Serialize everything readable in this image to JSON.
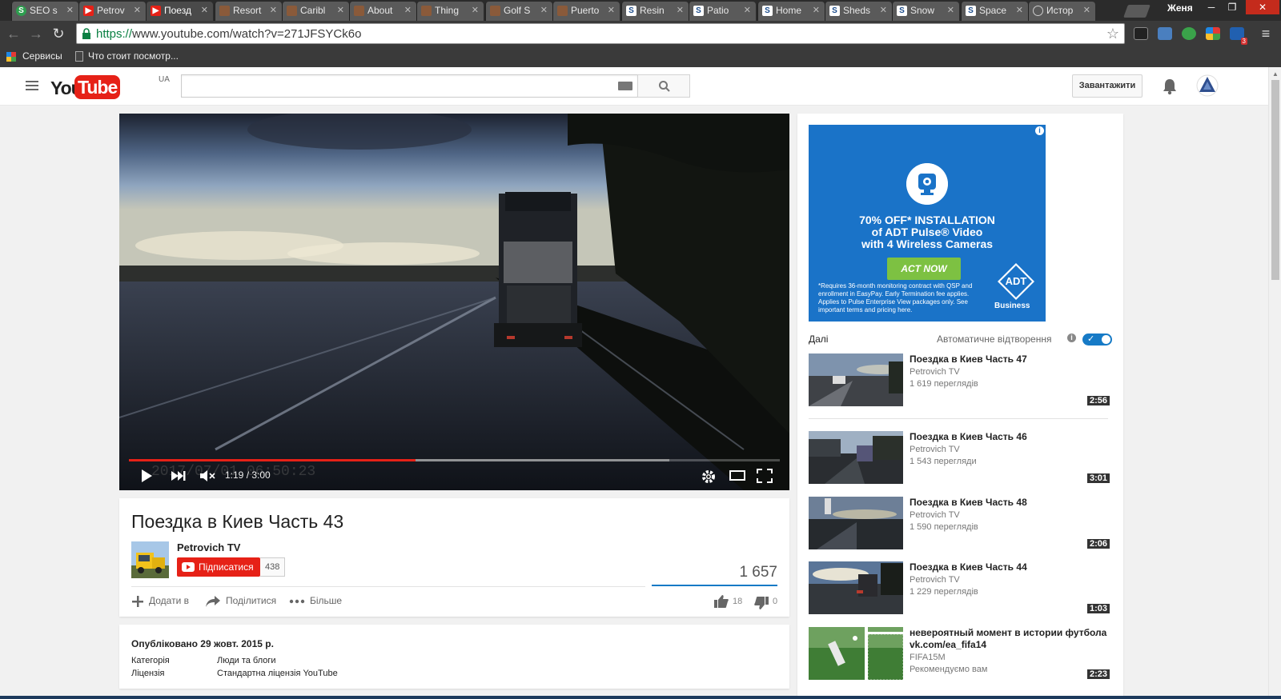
{
  "browser": {
    "tabs": [
      {
        "label": "SEO s",
        "favicon": "seo-icon"
      },
      {
        "label": "Petrov",
        "favicon": "youtube-icon"
      },
      {
        "label": "Поезд",
        "favicon": "youtube-icon"
      },
      {
        "label": "Resort",
        "favicon": "pottery-icon"
      },
      {
        "label": "Caribl",
        "favicon": "pottery-icon"
      },
      {
        "label": "About",
        "favicon": "pottery-icon"
      },
      {
        "label": "Thing",
        "favicon": "pottery-icon"
      },
      {
        "label": "Golf S",
        "favicon": "pottery-icon"
      },
      {
        "label": "Puerto",
        "favicon": "pottery-icon"
      },
      {
        "label": "Resin",
        "favicon": "s-icon"
      },
      {
        "label": "Patio",
        "favicon": "s-icon"
      },
      {
        "label": "Home",
        "favicon": "s-icon"
      },
      {
        "label": "Sheds",
        "favicon": "s-icon"
      },
      {
        "label": "Snow",
        "favicon": "s-icon"
      },
      {
        "label": "Space",
        "favicon": "s-icon"
      },
      {
        "label": "Истор",
        "favicon": "history-icon"
      }
    ],
    "user": "Женя",
    "url_scheme": "https://",
    "url_rest": "www.youtube.com/watch?v=271JFSYCk6o",
    "bookmarks": {
      "apps": "Сервисы",
      "item1": "Что стоит посмотр..."
    },
    "extension_badge": "3"
  },
  "masthead": {
    "logo_you": "You",
    "logo_tube": "Tube",
    "country": "UA",
    "search_placeholder": "",
    "upload_label": "Завантажити"
  },
  "player": {
    "time_current": "1:19",
    "time_total": "3:00",
    "time_display": "1:19 / 3:00",
    "played_fraction": 0.44,
    "loaded_fraction": 0.83
  },
  "video": {
    "title": "Поездка в Киев Часть 43",
    "channel": "Petrovich TV",
    "subscribe_label": "Підписатися",
    "subscriber_count": "438",
    "views": "1 657",
    "actions": {
      "add": "Додати в",
      "share": "Поділитися",
      "more": "Більше"
    },
    "likes": "18",
    "dislikes": "0",
    "published": "Опубліковано 29 жовт. 2015 р.",
    "category_label": "Категорія",
    "category_value": "Люди та блоги",
    "license_label": "Ліцензія",
    "license_value": "Стандартна ліцензія YouTube"
  },
  "ad": {
    "headline_1": "70% OFF* INSTALLATION",
    "headline_2": "of ADT Pulse® Video",
    "headline_3": "with 4 Wireless Cameras",
    "cta": "ACT NOW",
    "fineprint": "*Requires 36-month monitoring contract with QSP and enrollment in EasyPay. Early Termination fee applies. Applies to Pulse Enterprise View packages only. See important terms and pricing here.",
    "logo_text": "ADT",
    "logo_sub": "Business",
    "colors": {
      "bg": "#1a73c8",
      "cta": "#7dc142"
    }
  },
  "sidebar": {
    "up_next": "Далі",
    "autoplay": "Автоматичне відтворення",
    "recs": [
      {
        "title": "Поездка в Киев Часть 47",
        "channel": "Petrovich TV",
        "views": "1 619 переглядів",
        "duration": "2:56"
      },
      {
        "title": "Поездка в Киев Часть 46",
        "channel": "Petrovich TV",
        "views": "1 543 перегляди",
        "duration": "3:01"
      },
      {
        "title": "Поездка в Киев Часть 48",
        "channel": "Petrovich TV",
        "views": "1 590 переглядів",
        "duration": "2:06"
      },
      {
        "title": "Поездка в Киев Часть 44",
        "channel": "Petrovich TV",
        "views": "1 229 переглядів",
        "duration": "1:03"
      },
      {
        "title": "невероятный момент в истории футбола vk.com/ea_fifa14",
        "channel": "FIFA15M",
        "views": "Рекомендуємо вам",
        "duration": "2:23"
      }
    ]
  }
}
